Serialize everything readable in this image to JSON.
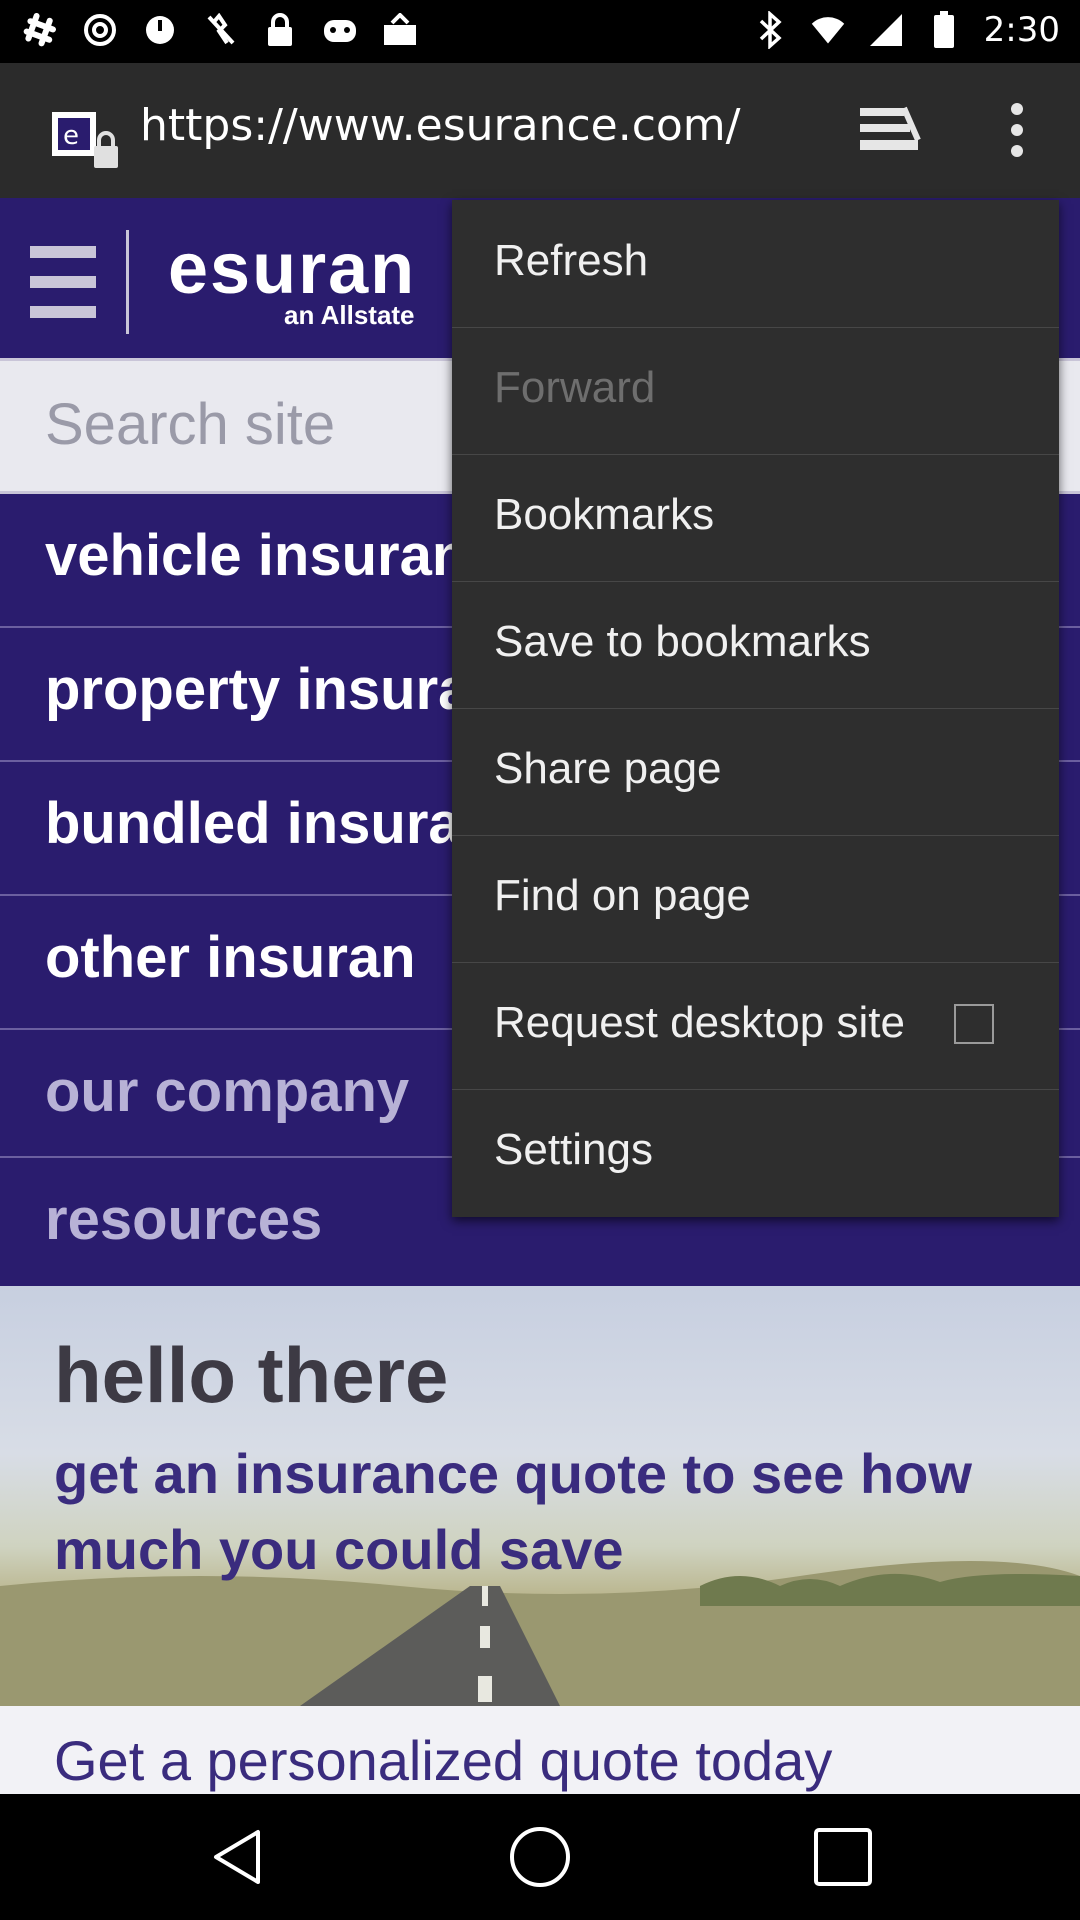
{
  "status_bar": {
    "time": "2:30",
    "left_icons": [
      "slack-icon",
      "at-icon",
      "timer-icon",
      "lightning-off-icon",
      "lock-icon",
      "game-controller-icon",
      "inbox-icon"
    ],
    "right_icons": [
      "bluetooth-icon",
      "wifi-icon",
      "signal-icon",
      "battery-icon"
    ]
  },
  "url_bar": {
    "url": "https://www.esurance.com/"
  },
  "page": {
    "brand": "esuran",
    "brand_sub": "an Allstate",
    "search_placeholder": "Search site",
    "nav_items": [
      {
        "label": "vehicle insuran"
      },
      {
        "label": "property insura"
      },
      {
        "label": "bundled insura"
      },
      {
        "label": "other insuran"
      },
      {
        "label": "our company"
      },
      {
        "label": "resources"
      }
    ],
    "hero_title": "hello there",
    "hero_subtitle": "get an insurance quote to see how much you could save",
    "quote_text": "Get a personalized quote today"
  },
  "menu": {
    "items": [
      {
        "label": "Refresh",
        "disabled": false
      },
      {
        "label": "Forward",
        "disabled": true
      },
      {
        "label": "Bookmarks",
        "disabled": false
      },
      {
        "label": "Save to bookmarks",
        "disabled": false
      },
      {
        "label": "Share page",
        "disabled": false
      },
      {
        "label": "Find on page",
        "disabled": false
      },
      {
        "label": "Request desktop site",
        "disabled": false,
        "checked": false
      },
      {
        "label": "Settings",
        "disabled": false
      }
    ]
  },
  "colors": {
    "page_bg": "#2a1c6e",
    "menu_bg": "#2e2e2e",
    "url_bar_bg": "#2b2b2b"
  }
}
